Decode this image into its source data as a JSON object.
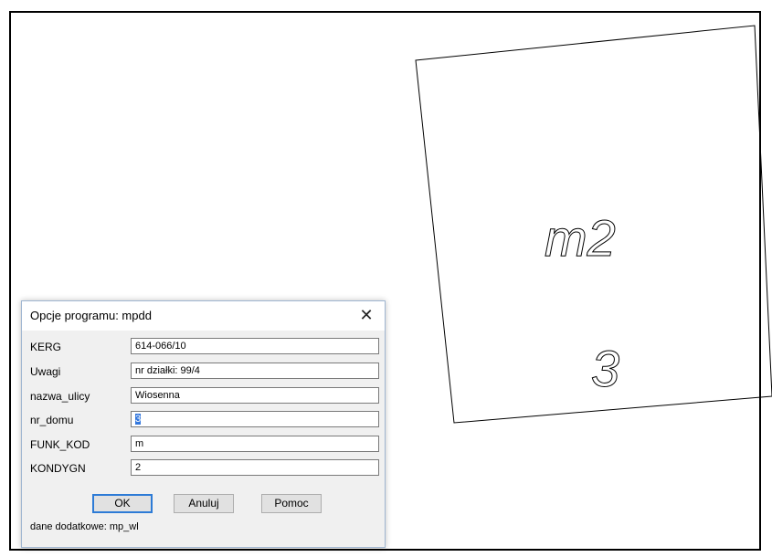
{
  "drawing": {
    "text_top": "m2",
    "text_bottom": "3"
  },
  "dialog": {
    "title": "Opcje programu: mpdd",
    "close_glyph": "✕",
    "fields": [
      {
        "label": "KERG",
        "value": "614-066/10"
      },
      {
        "label": "Uwagi",
        "value": "nr działki: 99/4"
      },
      {
        "label": "nazwa_ulicy",
        "value": "Wiosenna"
      },
      {
        "label": "nr_domu",
        "value": "3"
      },
      {
        "label": "FUNK_KOD",
        "value": "m"
      },
      {
        "label": "KONDYGN",
        "value": "2"
      }
    ],
    "ok_label": "OK",
    "cancel_label": "Anuluj",
    "help_label": "Pomoc",
    "footer": "dane dodatkowe: mp_wl"
  }
}
